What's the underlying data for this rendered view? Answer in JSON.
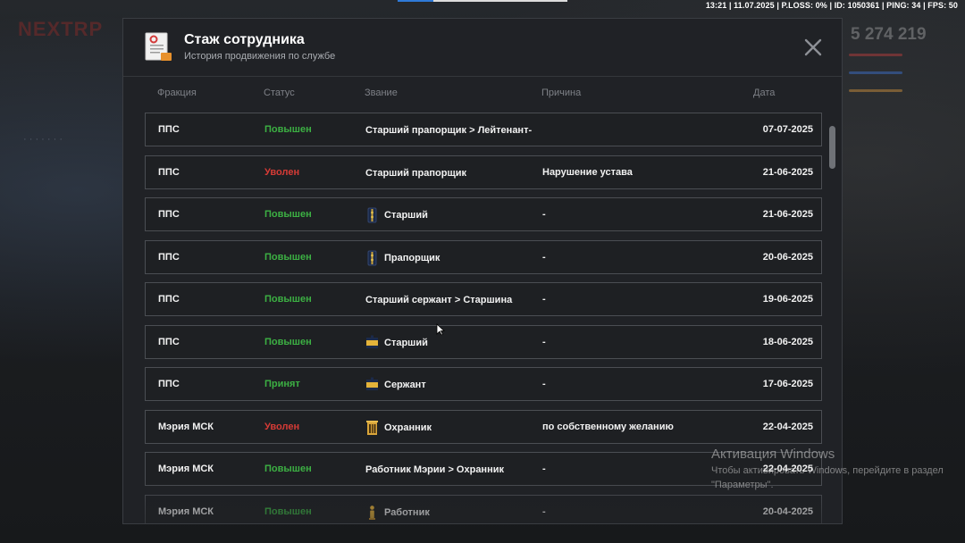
{
  "hud": {
    "info": "13:21 | 11.07.2025 | P.LOSS: 0% | ID: 1050361 | PING: 34 | FPS: 50",
    "money": "5 274 219",
    "logo": "NEXTRP"
  },
  "modal": {
    "icon": "document-icon",
    "title": "Стаж сотрудника",
    "subtitle": "История продвижения по службе",
    "columns": {
      "faction": "Фракция",
      "status": "Статус",
      "rank": "Звание",
      "reason": "Причина",
      "date": "Дата"
    },
    "rows": [
      {
        "faction": "ППС",
        "status": "Повышен",
        "status_type": "up",
        "rank": "Старший прапорщик > Лейтенант-",
        "rank_icon": "",
        "reason": "",
        "date": "07-07-2025"
      },
      {
        "faction": "ППС",
        "status": "Уволен",
        "status_type": "fired",
        "rank": "Старший прапорщик",
        "rank_icon": "",
        "reason": "Нарушение устава",
        "date": "21-06-2025"
      },
      {
        "faction": "ППС",
        "status": "Повышен",
        "status_type": "up",
        "rank": "Старший",
        "rank_icon": "shoulder-strap-stars-icon",
        "reason": "-",
        "date": "21-06-2025"
      },
      {
        "faction": "ППС",
        "status": "Повышен",
        "status_type": "up",
        "rank": "Прапорщик",
        "rank_icon": "shoulder-strap-stars-icon",
        "reason": "-",
        "date": "20-06-2025"
      },
      {
        "faction": "ППС",
        "status": "Повышен",
        "status_type": "up",
        "rank": "Старший сержант > Старшина",
        "rank_icon": "",
        "reason": "-",
        "date": "19-06-2025"
      },
      {
        "faction": "ППС",
        "status": "Повышен",
        "status_type": "up",
        "rank": "Старший",
        "rank_icon": "shoulder-strap-stripes-icon",
        "reason": "-",
        "date": "18-06-2025"
      },
      {
        "faction": "ППС",
        "status": "Принят",
        "status_type": "hired",
        "rank": "Сержант",
        "rank_icon": "shoulder-strap-stripes-icon",
        "reason": "-",
        "date": "17-06-2025"
      },
      {
        "faction": "Мэрия МСК",
        "status": "Уволен",
        "status_type": "fired",
        "rank": "Охранник",
        "rank_icon": "building-icon",
        "reason": "по собственному желанию",
        "date": "22-04-2025"
      },
      {
        "faction": "Мэрия МСК",
        "status": "Повышен",
        "status_type": "up",
        "rank": "Работник Мэрии > Охранник",
        "rank_icon": "",
        "reason": "-",
        "date": "22-04-2025"
      },
      {
        "faction": "Мэрия МСК",
        "status": "Повышен",
        "status_type": "up",
        "rank": "Работник",
        "rank_icon": "worker-icon",
        "reason": "-",
        "date": "20-04-2025"
      }
    ]
  },
  "windows_activation": {
    "title": "Активация Windows",
    "text": "Чтобы активировать Windows, перейдите в раздел \"Параметры\"."
  },
  "colors": {
    "status_up": "#3cb043",
    "status_fired": "#d63b36",
    "modal_bg": "#202226"
  }
}
